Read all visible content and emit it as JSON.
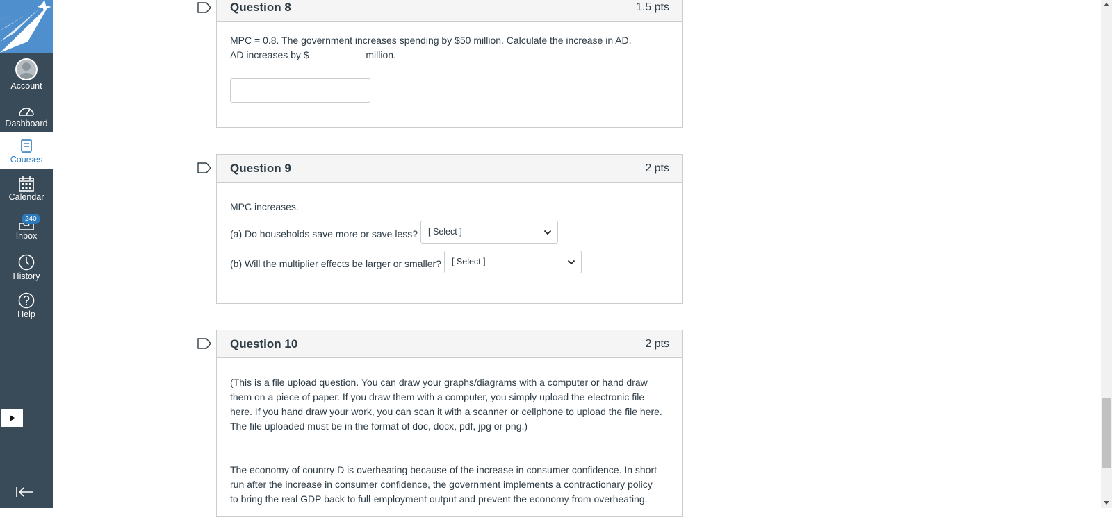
{
  "nav": {
    "account": "Account",
    "dashboard": "Dashboard",
    "courses": "Courses",
    "calendar": "Calendar",
    "inbox": "Inbox",
    "inbox_badge": "240",
    "history": "History",
    "help": "Help"
  },
  "colors": {
    "nav_bg": "#394b58",
    "logo_bg": "#4f8fce",
    "accent": "#2b7abc"
  },
  "questions": {
    "q8": {
      "title": "Question 8",
      "points": "1.5 pts",
      "line1": "MPC = 0.8. The government increases spending by $50 million. Calculate the increase in AD.",
      "line2": "AD increases by $__________ million.",
      "answer": ""
    },
    "q9": {
      "title": "Question 9",
      "points": "2 pts",
      "intro": "MPC increases.",
      "part_a": "(a) Do households save more or save less?",
      "part_a_select": "[ Select ]",
      "part_b": "(b) Will the multiplier effects be larger or smaller?",
      "part_b_select": "[ Select ]"
    },
    "q10": {
      "title": "Question 10",
      "points": "2 pts",
      "para1_l1": "(This is a file upload question. You can draw your graphs/diagrams with a computer or hand draw",
      "para1_l2": "them on a piece of paper. If you draw them with a computer, you simply upload the electronic file",
      "para1_l3": "here. If you hand draw your work, you can scan it with a scanner or cellphone to upload the file here.",
      "para1_l4": "The file uploaded must be in the format of doc, docx, pdf, jpg or png.)",
      "para2_l1": "The economy of country D is overheating because of the increase in consumer confidence. In short",
      "para2_l2": "run after the increase in consumer confidence, the government implements a contractionary policy",
      "para2_l3": "to bring the real GDP back to full-employment output and prevent the economy from overheating."
    }
  }
}
